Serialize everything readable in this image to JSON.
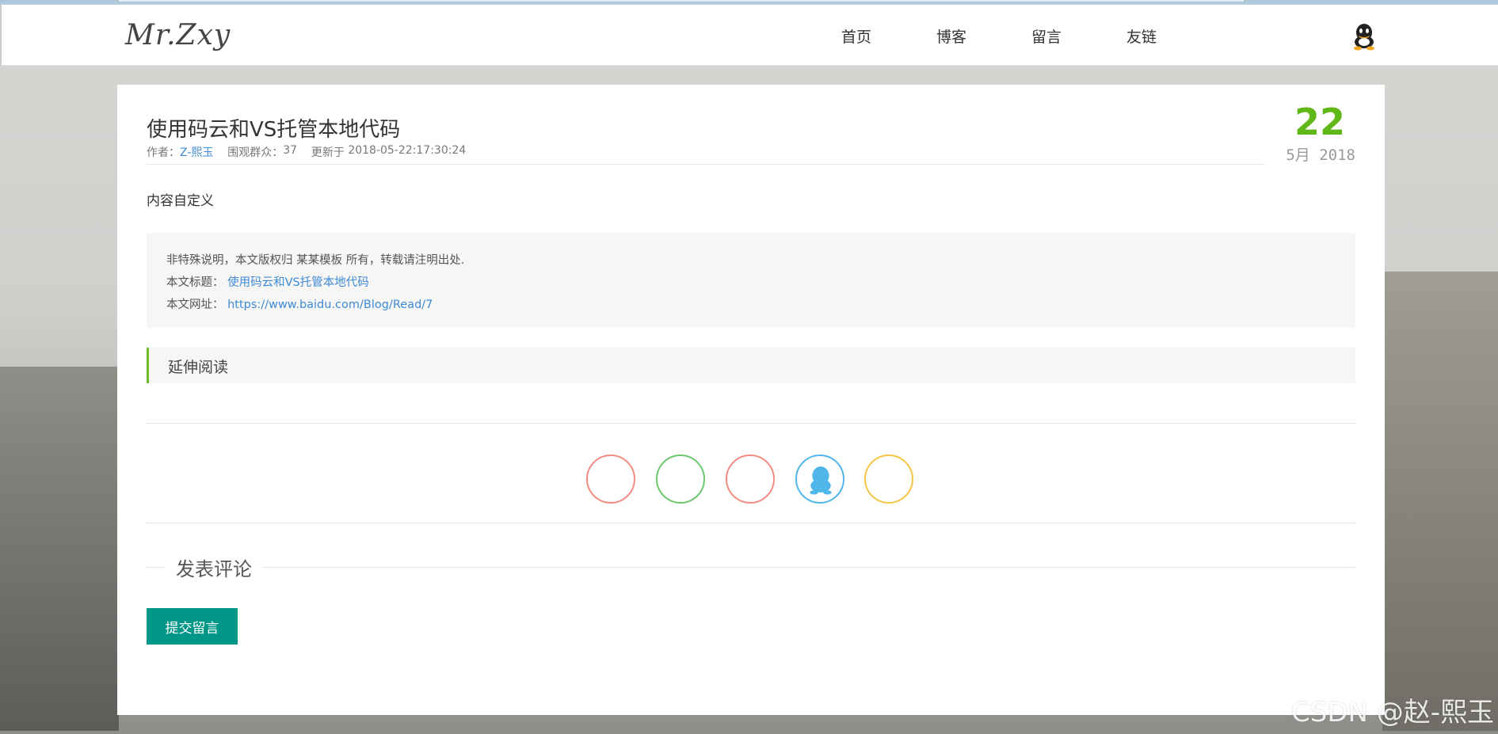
{
  "header": {
    "logo": "Mr.Zxy",
    "nav": [
      "首页",
      "博客",
      "留言",
      "友链"
    ],
    "user_icon": "qq-icon"
  },
  "article": {
    "title": "使用码云和VS托管本地代码",
    "meta": {
      "author_label": "作者：",
      "author": "Z-熙玉",
      "views_label": "围观群众：",
      "views": "37",
      "updated_label": "更新于 ",
      "updated": "2018-05-22:17:30:24"
    },
    "date": {
      "day": "22",
      "month": "5月",
      "year": "2018"
    },
    "content": "内容自定义",
    "notice": {
      "line1": "非特殊说明，本文版权归 某某模板 所有，转载请注明出处.",
      "title_label": "本文标题：",
      "title_value": "使用码云和VS托管本地代码",
      "url_label": "本文网址：",
      "url_value": "https://www.baidu.com/Blog/Read/7"
    },
    "extended_reading": "延伸阅读"
  },
  "share": {
    "icons": [
      "share-icon-1",
      "share-icon-2",
      "share-icon-3",
      "qq-icon",
      "share-icon-5"
    ],
    "colors": [
      "#f08c82",
      "#6cc76c",
      "#f08c82",
      "#4fb6e9",
      "#f7c545"
    ]
  },
  "comment": {
    "title": "发表评论",
    "submit_label": "提交留言"
  },
  "watermark": "CSDN @赵-熙玉",
  "colors": {
    "accent_green": "#5fb818",
    "link_blue": "#3e8ad6",
    "submit_teal": "#009688"
  }
}
